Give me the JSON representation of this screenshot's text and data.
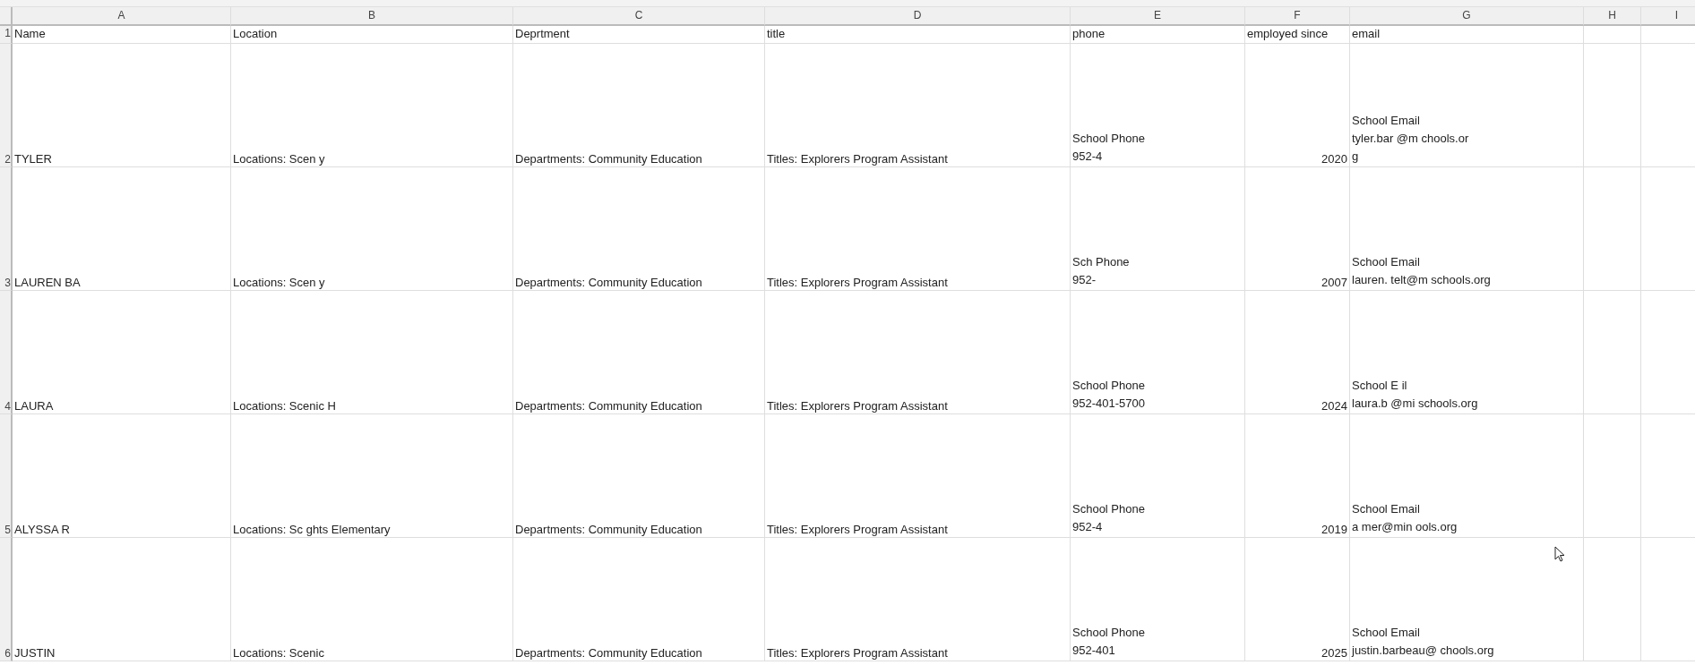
{
  "columns": [
    "A",
    "B",
    "C",
    "D",
    "E",
    "F",
    "G",
    "H",
    "I"
  ],
  "header_row": {
    "number": "1",
    "cells": [
      "Name",
      "Location",
      "Deprtment",
      "title",
      "phone",
      "employed since",
      "email"
    ]
  },
  "rows": [
    {
      "number": "2",
      "name": "TYLER",
      "location": "Locations: Scen y",
      "department": "Departments: Community Education",
      "title": "Titles: Explorers Program Assistant",
      "phone": [
        "School Phone",
        "952-4"
      ],
      "employed_since": "2020",
      "email": [
        "School Email",
        "tyler.bar @m chools.or",
        "g"
      ]
    },
    {
      "number": "3",
      "name": "LAUREN BA",
      "location": "Locations: Scen y",
      "department": "Departments: Community Education",
      "title": "Titles: Explorers Program Assistant",
      "phone": [
        "Sch Phone",
        "952-"
      ],
      "employed_since": "2007",
      "email": [
        "School Email",
        "lauren. telt@m schools.org"
      ]
    },
    {
      "number": "4",
      "name": "LAURA",
      "location": "Locations: Scenic H",
      "department": "Departments: Community Education",
      "title": "Titles: Explorers Program Assistant",
      "phone": [
        "School Phone",
        "952-401-5700"
      ],
      "employed_since": "2024",
      "email": [
        "School E il",
        "laura.b @mi schools.org"
      ]
    },
    {
      "number": "5",
      "name": "ALYSSA R",
      "location": "Locations: Sc ghts Elementary",
      "department": "Departments: Community Education",
      "title": "Titles: Explorers Program Assistant",
      "phone": [
        "School Phone",
        "952-4"
      ],
      "employed_since": "2019",
      "email": [
        "School Email",
        "a mer@min ools.org"
      ]
    },
    {
      "number": "6",
      "name": "JUSTIN",
      "location": "Locations: Scenic",
      "department": "Departments: Community Education",
      "title": "Titles: Explorers Program Assistant",
      "phone": [
        "School Phone",
        "952-401"
      ],
      "employed_since": "2025",
      "email": [
        "School Email",
        "justin.barbeau@ chools.org"
      ]
    }
  ]
}
